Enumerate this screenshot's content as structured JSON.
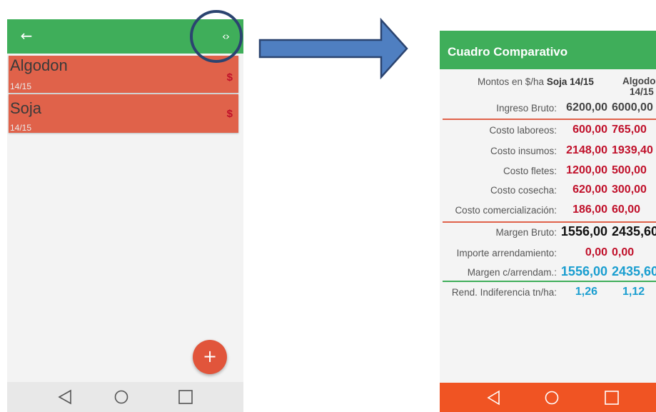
{
  "colors": {
    "appbar_green": "#3fae5a",
    "list_item_red": "#e0624a",
    "dollar_red": "#c0102a",
    "value_red": "#c0102a",
    "value_black": "#111111",
    "value_blue": "#1a9ed0",
    "divider_red": "#e0624a",
    "divider_green": "#3fae5a",
    "fab_red": "#e1553b",
    "arrow_blue": "#4f7fc1",
    "arrow_border": "#2b4470",
    "nav_orange": "#f05423"
  },
  "left_screen": {
    "back_icon": "back-arrow-icon",
    "back_glyph": "←",
    "compare_icon": "code-brackets-icon",
    "compare_glyph": "‹›",
    "items": [
      {
        "title": "Algodon",
        "subtitle": "14/15",
        "badge": "$"
      },
      {
        "title": "Soja",
        "subtitle": "14/15",
        "badge": "$"
      }
    ],
    "fab_glyph": "+",
    "nav": [
      "back-triangle-icon",
      "home-circle-icon",
      "recents-square-icon"
    ]
  },
  "right_screen": {
    "title": "Cuadro Comparativo",
    "header": {
      "label_prefix": "Montos en $/ha",
      "col1": "Soja 14/15",
      "col2_line1": "Algodon",
      "col2_line2": "14/15"
    },
    "rows": [
      {
        "label": "Ingreso Bruto:",
        "v1": "6200,00",
        "v2": "6000,00",
        "color": "#444444"
      },
      {
        "label": "Costo laboreos:",
        "v1": "600,00",
        "v2": "765,00",
        "color": "#c0102a"
      },
      {
        "label": "Costo insumos:",
        "v1": "2148,00",
        "v2": "1939,40",
        "color": "#c0102a"
      },
      {
        "label": "Costo fletes:",
        "v1": "1200,00",
        "v2": "500,00",
        "color": "#c0102a"
      },
      {
        "label": "Costo cosecha:",
        "v1": "620,00",
        "v2": "300,00",
        "color": "#c0102a"
      },
      {
        "label": "Costo comercialización:",
        "v1": "186,00",
        "v2": "60,00",
        "color": "#c0102a"
      },
      {
        "label": "Margen Bruto:",
        "v1": "1556,00",
        "v2": "2435,60",
        "color": "#111111"
      },
      {
        "label": "Importe arrendamiento:",
        "v1": "0,00",
        "v2": "0,00",
        "color": "#c0102a"
      },
      {
        "label": "Margen c/arrendam.:",
        "v1": "1556,00",
        "v2": "2435,60",
        "color": "#1a9ed0"
      },
      {
        "label": "Rend. Indiferencia tn/ha:",
        "v1": "1,26",
        "v2": "1,12",
        "color": "#1a9ed0"
      }
    ],
    "nav": [
      "back-triangle-icon",
      "home-circle-icon",
      "recents-square-icon"
    ]
  }
}
